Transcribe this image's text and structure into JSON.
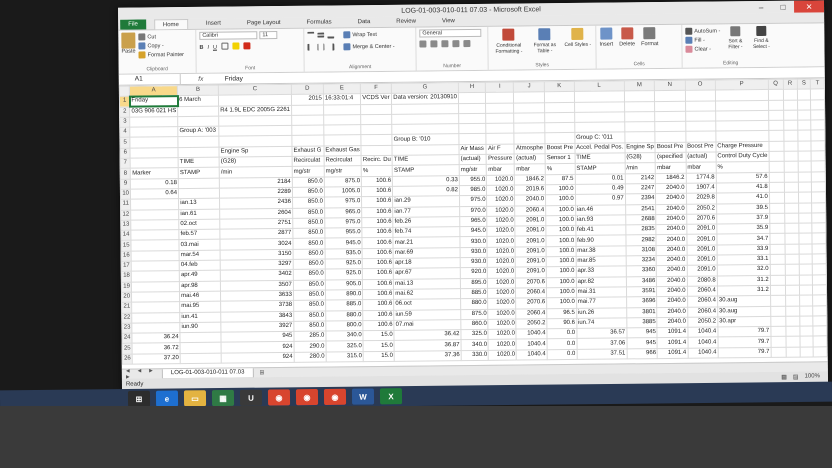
{
  "window": {
    "title": "LOG-01-003-010-011 07.03 - Microsoft Excel",
    "min_label": "–",
    "max_label": "□",
    "close_label": "✕"
  },
  "ribbon_tabs": [
    "File",
    "Home",
    "Insert",
    "Page Layout",
    "Formulas",
    "Data",
    "Review",
    "View"
  ],
  "ribbon": {
    "clipboard": {
      "paste": "Paste",
      "cut": "Cut",
      "copy": "Copy -",
      "format_painter": "Format Painter",
      "label": "Clipboard"
    },
    "font": {
      "font_name": "Calibri",
      "font_size": "11",
      "bold": "B",
      "italic": "I",
      "underline": "U",
      "label": "Font"
    },
    "alignment": {
      "wrap_text": "Wrap Text",
      "merge_center": "Merge & Center -",
      "label": "Alignment"
    },
    "number": {
      "format": "General",
      "label": "Number"
    },
    "styles": {
      "conditional": "Conditional Formatting -",
      "format_table": "Format as Table -",
      "cell_styles": "Cell Styles -",
      "label": "Styles"
    },
    "cells": {
      "insert": "Insert",
      "delete": "Delete",
      "format": "Format",
      "label": "Cells"
    },
    "editing": {
      "autosum": "AutoSum -",
      "fill": "Fill -",
      "clear": "Clear -",
      "sort_filter": "Sort & Filter -",
      "find_select": "Find & Select -",
      "label": "Editing"
    }
  },
  "formula_bar": {
    "name_box": "A1",
    "fx": "fx",
    "formula": "Friday"
  },
  "columns": [
    "A",
    "B",
    "C",
    "D",
    "E",
    "F",
    "G",
    "H",
    "I",
    "J",
    "K",
    "L",
    "M",
    "N",
    "O",
    "P",
    "Q",
    "R",
    "S",
    "T"
  ],
  "rows": [
    [
      "Friday",
      "6 March",
      "",
      "2015",
      "16:33:01:4",
      "VCDS Ver",
      "Data version: 20130910",
      "",
      "",
      "",
      "",
      "",
      "",
      "",
      "",
      "",
      "",
      "",
      "",
      ""
    ],
    [
      "03G 906 021 HS",
      "",
      "R4 1.9L EDC 2005G 2261",
      "",
      "",
      "",
      "",
      "",
      "",
      "",
      "",
      "",
      "",
      "",
      "",
      "",
      "",
      "",
      "",
      ""
    ],
    [
      "",
      "",
      "",
      "",
      "",
      "",
      "",
      "",
      "",
      "",
      "",
      "",
      "",
      "",
      "",
      "",
      "",
      "",
      "",
      ""
    ],
    [
      "",
      "Group A: '003",
      "",
      "",
      "",
      "",
      "",
      "",
      "",
      "",
      "",
      "",
      "",
      "",
      "",
      "",
      "",
      "",
      "",
      ""
    ],
    [
      "",
      "",
      "",
      "",
      "",
      "",
      "Group B: '010",
      "",
      "",
      "",
      "",
      "Group C: '011",
      "",
      "",
      "",
      "",
      "",
      "",
      "",
      ""
    ],
    [
      "",
      "",
      "Engine Sp",
      "Exhaust G",
      "Exhaust Gas",
      "",
      "",
      "Air Mass",
      "Air F",
      "Atmosphe",
      "Boost Pre",
      "Accel. Pedal Pos.",
      "Engine Sp",
      "Boost Pre",
      "Boost Pre",
      "Charge Pressure",
      "",
      "",
      "",
      ""
    ],
    [
      "",
      "TIME",
      "(G28)",
      "Recirculat",
      "Recirculat",
      "Recirc. Du",
      "TIME",
      "(actual)",
      "Pressure",
      "(actual)",
      "Sensor 1",
      "TIME",
      "(G28)",
      "(specified",
      "(actual)",
      "Control Duty Cycle",
      "",
      "",
      "",
      ""
    ],
    [
      "Marker",
      "STAMP",
      "/min",
      "mg/str",
      "mg/str",
      "%",
      "STAMP",
      "mg/str",
      "mbar",
      "mbar",
      "%",
      "STAMP",
      "/min",
      "mbar",
      "mbar",
      "%",
      "",
      "",
      "",
      ""
    ],
    [
      "0.18",
      "",
      "2184",
      "850.0",
      "875.0",
      "100.6",
      "0.33",
      "955.0",
      "1020.0",
      "1846.2",
      "87.5",
      "0.01",
      "2142",
      "1846.2",
      "1774.8",
      "57.6",
      "",
      "",
      "",
      ""
    ],
    [
      "0.64",
      "",
      "2289",
      "850.0",
      "1005.0",
      "100.6",
      "0.82",
      "985.0",
      "1020.0",
      "2019.6",
      "100.0",
      "0.49",
      "2247",
      "2040.0",
      "1907.4",
      "41.8",
      "",
      "",
      "",
      ""
    ],
    [
      "",
      "ian.13",
      "2436",
      "850.0",
      "975.0",
      "100.6",
      "ian.29",
      "975.0",
      "1020.0",
      "2040.0",
      "100.0",
      "0.97",
      "2394",
      "2040.0",
      "2029.8",
      "41.0",
      "",
      "",
      "",
      ""
    ],
    [
      "",
      "ian.61",
      "2604",
      "850.0",
      "965.0",
      "100.6",
      "ian.77",
      "970.0",
      "1020.0",
      "2060.4",
      "100.0",
      "ian.46",
      "2541",
      "2040.0",
      "2050.2",
      "39.5",
      "",
      "",
      "",
      ""
    ],
    [
      "",
      "02.oct",
      "2751",
      "850.0",
      "975.0",
      "100.6",
      "feb.26",
      "965.0",
      "1020.0",
      "2091.0",
      "100.0",
      "ian.93",
      "2688",
      "2040.0",
      "2070.6",
      "37.9",
      "",
      "",
      "",
      ""
    ],
    [
      "",
      "feb.57",
      "2877",
      "850.0",
      "955.0",
      "100.6",
      "feb.74",
      "945.0",
      "1020.0",
      "2091.0",
      "100.0",
      "feb.41",
      "2835",
      "2040.0",
      "2091.0",
      "35.9",
      "",
      "",
      "",
      ""
    ],
    [
      "",
      "03.mai",
      "3024",
      "850.0",
      "945.0",
      "100.6",
      "mar.21",
      "930.0",
      "1020.0",
      "2091.0",
      "100.0",
      "feb.90",
      "2982",
      "2040.0",
      "2091.0",
      "34.7",
      "",
      "",
      "",
      ""
    ],
    [
      "",
      "mar.54",
      "3150",
      "850.0",
      "935.0",
      "100.6",
      "mar.69",
      "930.0",
      "1020.0",
      "2091.0",
      "100.0",
      "mar.38",
      "3108",
      "2040.0",
      "2091.0",
      "33.9",
      "",
      "",
      "",
      ""
    ],
    [
      "",
      "04.feb",
      "3297",
      "850.0",
      "925.0",
      "100.6",
      "apr.18",
      "930.0",
      "1020.0",
      "2091.0",
      "100.0",
      "mar.85",
      "3234",
      "2040.0",
      "2091.0",
      "33.1",
      "",
      "",
      "",
      ""
    ],
    [
      "",
      "apr.49",
      "3402",
      "850.0",
      "925.0",
      "100.6",
      "apr.67",
      "920.0",
      "1020.0",
      "2091.0",
      "100.0",
      "apr.33",
      "3360",
      "2040.0",
      "2091.0",
      "32.0",
      "",
      "",
      "",
      ""
    ],
    [
      "",
      "apr.98",
      "3507",
      "850.0",
      "905.0",
      "100.6",
      "mai.13",
      "895.0",
      "1020.0",
      "2070.6",
      "100.0",
      "apr.82",
      "3486",
      "2040.0",
      "2080.8",
      "31.2",
      "",
      "",
      "",
      ""
    ],
    [
      "",
      "mai.46",
      "3633",
      "850.0",
      "890.0",
      "100.6",
      "mai.62",
      "885.0",
      "1020.0",
      "2060.4",
      "100.0",
      "mai.31",
      "3591",
      "2040.0",
      "2060.4",
      "31.2",
      "",
      "",
      "",
      ""
    ],
    [
      "",
      "mai.95",
      "3738",
      "850.0",
      "885.0",
      "100.6",
      "06.oct",
      "880.0",
      "1020.0",
      "2070.6",
      "100.0",
      "mai.77",
      "3696",
      "2040.0",
      "2060.4",
      "30.aug",
      "",
      "",
      "",
      ""
    ],
    [
      "",
      "iun.41",
      "3843",
      "850.0",
      "880.0",
      "100.6",
      "iun.59",
      "875.0",
      "1020.0",
      "2060.4",
      "96.5",
      "iun.26",
      "3801",
      "2040.0",
      "2060.4",
      "30.aug",
      "",
      "",
      "",
      ""
    ],
    [
      "",
      "iun.90",
      "3927",
      "850.0",
      "800.0",
      "100.6",
      "07.mai",
      "860.0",
      "1020.0",
      "2050.2",
      "90.6",
      "iun.74",
      "3885",
      "2040.0",
      "2050.2",
      "30.apr",
      "",
      "",
      "",
      ""
    ],
    [
      "36.24",
      "",
      "945",
      "285.0",
      "340.0",
      "15.0",
      "36.42",
      "325.0",
      "1020.0",
      "1040.4",
      "0.0",
      "36.57",
      "945",
      "1091.4",
      "1040.4",
      "79.7",
      "",
      "",
      "",
      ""
    ],
    [
      "36.72",
      "",
      "924",
      "290.0",
      "325.0",
      "15.0",
      "36.87",
      "340.0",
      "1020.0",
      "1040.4",
      "0.0",
      "37.06",
      "945",
      "1091.4",
      "1040.4",
      "79.7",
      "",
      "",
      "",
      ""
    ],
    [
      "37.20",
      "",
      "924",
      "280.0",
      "315.0",
      "15.0",
      "37.36",
      "330.0",
      "1020.0",
      "1040.4",
      "0.0",
      "37.51",
      "966",
      "1091.4",
      "1040.4",
      "79.7",
      "",
      "",
      "",
      ""
    ]
  ],
  "sheet_tabs": [
    "LOG-01-003-010-011 07.03"
  ],
  "sheet_nav": "◄ ◄ ► ►",
  "status": {
    "mode": "Ready",
    "zoom": "100%"
  },
  "taskbar_icons": [
    "windows-start",
    "internet-explorer",
    "file-explorer",
    "calculator",
    "um-app",
    "chrome-1",
    "chrome-2",
    "chrome-3",
    "word",
    "excel"
  ]
}
